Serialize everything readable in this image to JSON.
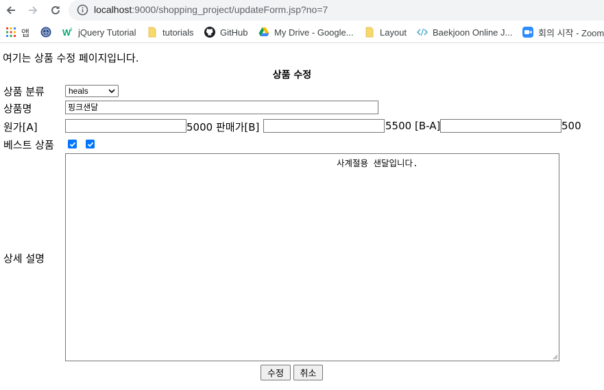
{
  "browser": {
    "url_host": "localhost",
    "url_path": ":9000/shopping_project/updateForm.jsp?no=7",
    "bookmarks": [
      {
        "label": "앱",
        "icon": "apps-grid-icon"
      },
      {
        "label": "",
        "icon": "globe-seal-icon"
      },
      {
        "label": "jQuery Tutorial",
        "icon": "w3schools-icon"
      },
      {
        "label": "tutorials",
        "icon": "folder-icon"
      },
      {
        "label": "GitHub",
        "icon": "github-icon"
      },
      {
        "label": "My Drive - Google...",
        "icon": "google-drive-icon"
      },
      {
        "label": "Layout",
        "icon": "folder-icon"
      },
      {
        "label": "Baekjoon Online J...",
        "icon": "code-brackets-icon"
      },
      {
        "label": "회의 시작 - Zoom",
        "icon": "zoom-icon"
      }
    ]
  },
  "page": {
    "intro": "여기는 상품 수정 페이지입니다.",
    "form_title": "상품 수정",
    "category_label": "상품 분류",
    "category_value": "heals",
    "name_label": "상품명",
    "name_value": "핑크샌달",
    "cost_label": "원가[A]",
    "cost_value": "",
    "cost_suffix": "5000",
    "sale_label": "판매가[B]",
    "sale_value": "",
    "sale_suffix": "5500",
    "margin_label": "[B-A]",
    "margin_value": "",
    "margin_suffix": "500",
    "best_label": "베스트 상품",
    "best_checked": [
      true,
      true
    ],
    "desc_label": "상세 설명",
    "desc_value": "사계절용 샌달입니다.",
    "submit_label": "수정",
    "cancel_label": "취소"
  },
  "colors": {
    "checkbox": "#0075ff",
    "omnibox_bg": "#f1f3f4",
    "button_bg": "#efefef"
  }
}
